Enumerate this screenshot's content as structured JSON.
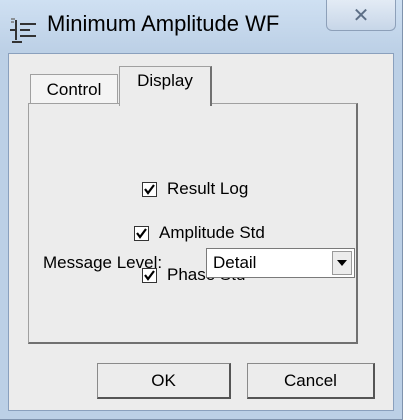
{
  "window": {
    "title": "Minimum Amplitude WF",
    "app_icon": "waveform-app-icon",
    "close_glyph": "✕"
  },
  "tabs": [
    {
      "label": "Control",
      "selected": false
    },
    {
      "label": "Display",
      "selected": true
    }
  ],
  "display": {
    "checkboxes": [
      {
        "label": "Result Log",
        "checked": true
      },
      {
        "label": "Amplitude Std",
        "checked": true
      },
      {
        "label": "Phase Std",
        "checked": true
      }
    ],
    "message_level": {
      "label": "Message Level:",
      "value": "Detail"
    }
  },
  "buttons": {
    "ok": "OK",
    "cancel": "Cancel"
  },
  "colors": {
    "frame": "#bcd0e6",
    "client": "#ececec",
    "close_glyph": "#5d6f86"
  }
}
